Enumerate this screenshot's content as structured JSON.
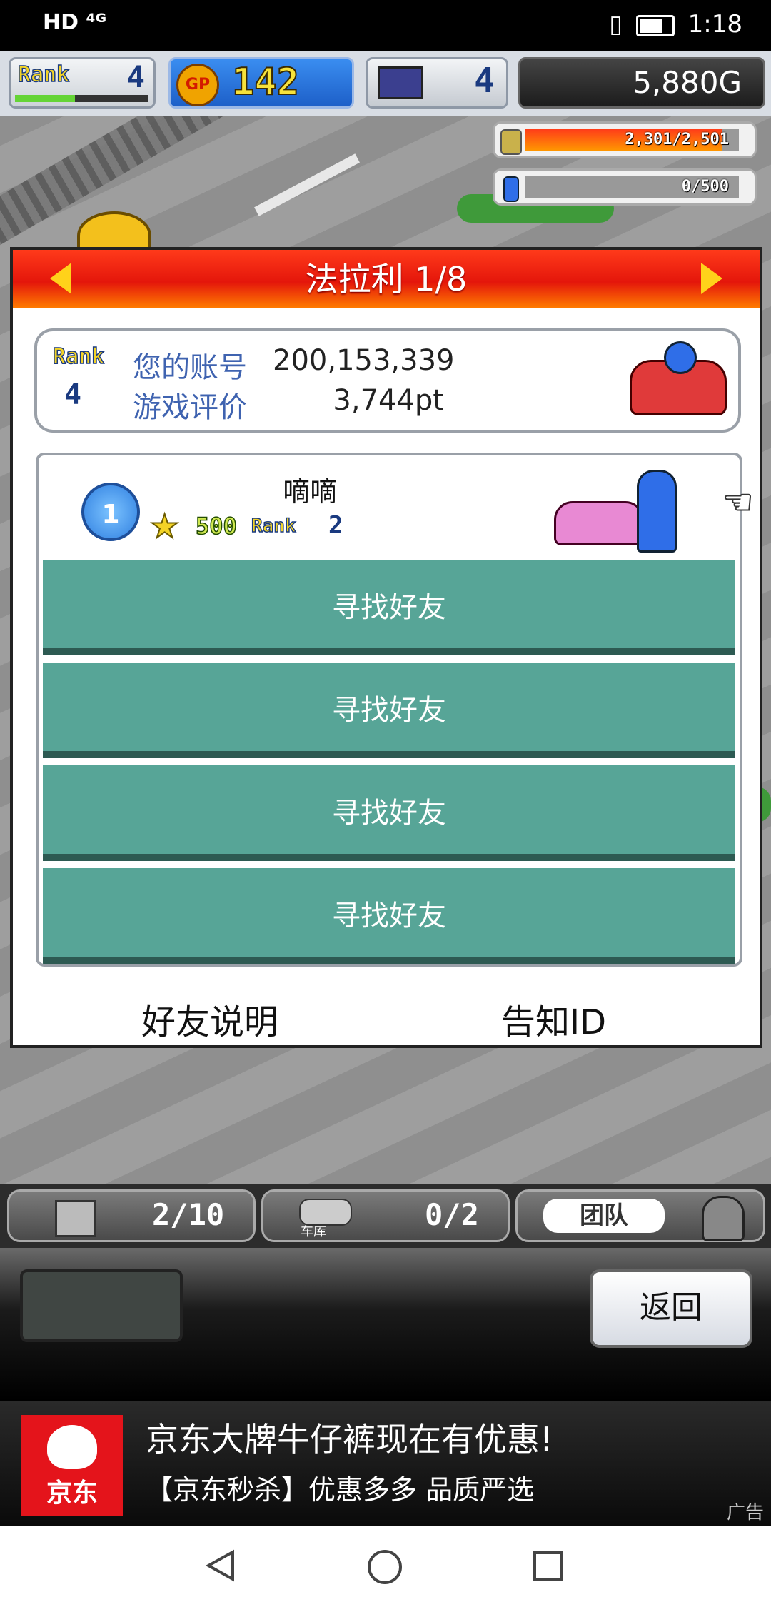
{
  "status_bar": {
    "left": "HD ⁴ᴳ",
    "time": "1:18"
  },
  "hud": {
    "rank_label": "Rank",
    "rank_value": "4",
    "gp_label": "GP",
    "gp_value": "142",
    "pc_value": "4",
    "money": "5,880G",
    "rank_progress": 0.45
  },
  "resources": [
    {
      "text": "2,301/2,501",
      "fill": 0.92,
      "color": "#ff3a1a"
    },
    {
      "text": "0/500",
      "fill": 0.0,
      "color": "#888888"
    }
  ],
  "dialog": {
    "title": "法拉利 1/8",
    "rank_label": "Rank",
    "rank_value": "4",
    "account_label": "您的账号",
    "account_value": "200,153,339",
    "rating_label": "游戏评价",
    "rating_value": "3,744pt",
    "friend": {
      "index": "1",
      "name": "嘀嘀",
      "score": "500",
      "rank_label": "Rank",
      "rank_value": "2"
    },
    "find_buttons": [
      "寻找好友",
      "寻找好友",
      "寻找好友",
      "寻找好友"
    ],
    "footer_left": "好友说明",
    "footer_right": "告知ID"
  },
  "bottom_bar": {
    "storage": "2/10",
    "garage_label": "车库",
    "garage": "0/2",
    "team": "团队"
  },
  "command_panel": {
    "back": "返回"
  },
  "ad": {
    "logo": "京东",
    "title": "京东大牌牛仔裤现在有优惠!",
    "subtitle": "【京东秒杀】优惠多多 品质严选",
    "tag": "广告"
  },
  "icons": [
    "battery-icon",
    "wifi-icon",
    "vibrate-icon",
    "coin-icon",
    "bottle-icon",
    "computer-icon",
    "star-icon",
    "hand-pointer-icon",
    "back-nav-icon",
    "home-nav-icon",
    "recent-nav-icon"
  ]
}
